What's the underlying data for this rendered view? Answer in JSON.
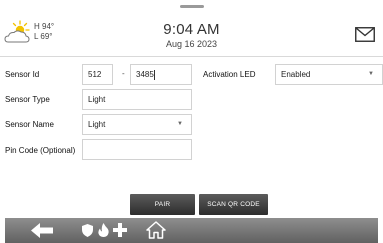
{
  "header": {
    "weather": {
      "high": "H 94°",
      "low": "L 69°",
      "icon": "partly-cloudy-icon"
    },
    "time": "9:04 AM",
    "date": "Aug 16 2023",
    "mail_icon": "mail-icon"
  },
  "form": {
    "sensor_id": {
      "label": "Sensor Id",
      "prefix": "512",
      "separator": "-",
      "value": "3485"
    },
    "activation_led": {
      "label": "Activation LED",
      "value": "Enabled"
    },
    "sensor_type": {
      "label": "Sensor Type",
      "value": "Light"
    },
    "sensor_name": {
      "label": "Sensor Name",
      "value": "Light"
    },
    "pin_code": {
      "label": "Pin Code (Optional)",
      "value": ""
    }
  },
  "buttons": {
    "pair": "PAIR",
    "scan_qr": "SCAN QR CODE"
  },
  "bottom_bar": {
    "icons": [
      "back-arrow-icon",
      "shield-icon",
      "fire-icon",
      "medical-cross-icon",
      "home-icon"
    ]
  },
  "colors": {
    "bar": "#6f6f6f",
    "button": "#3a3a3a",
    "weather_sun": "#f2c200"
  }
}
